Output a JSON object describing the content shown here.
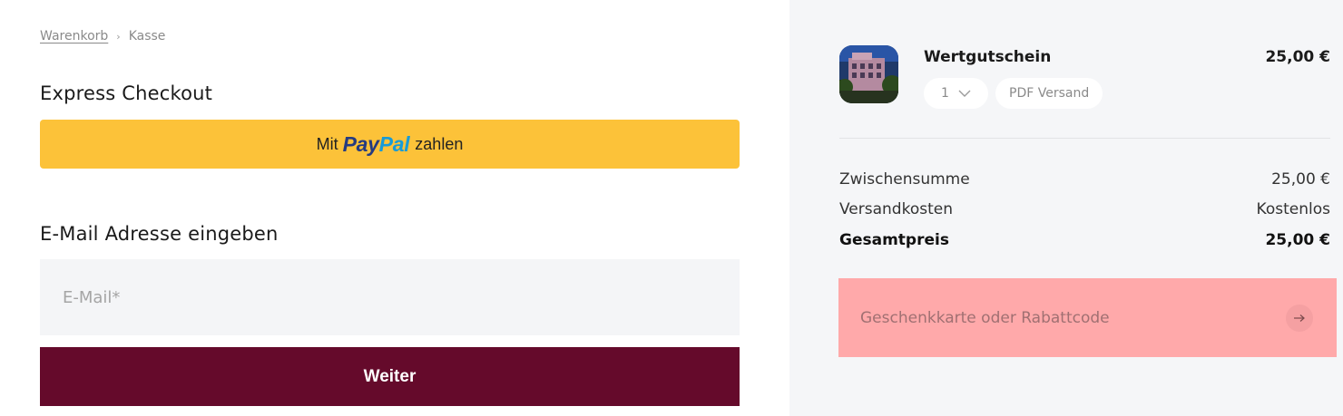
{
  "breadcrumb": {
    "cart": "Warenkorb",
    "separator": "›",
    "current": "Kasse"
  },
  "express": {
    "title": "Express Checkout",
    "paypal_prefix": "Mit",
    "paypal_logo_pay": "Pay",
    "paypal_logo_pal": "Pal",
    "paypal_suffix": "zahlen"
  },
  "email": {
    "title": "E-Mail Adresse eingeben",
    "placeholder": "E-Mail*",
    "submit_label": "Weiter"
  },
  "cart": {
    "item": {
      "name": "Wertgutschein",
      "price": "25,00 €",
      "quantity": "1",
      "shipping_method": "PDF Versand"
    },
    "summary": [
      {
        "label": "Zwischensumme",
        "value": "25,00 €"
      },
      {
        "label": "Versandkosten",
        "value": "Kostenlos"
      },
      {
        "label": "Gesamtpreis",
        "value": "25,00 €"
      }
    ],
    "coupon_placeholder": "Geschenkkarte oder Rabattcode"
  },
  "colors": {
    "paypal_button": "#fcc239",
    "submit_button": "#650a2b",
    "coupon_highlight": "#ffa9aa",
    "sidebar_background": "#f5f6f8"
  },
  "icons": {
    "quantity_dropdown": "chevron-down-icon",
    "coupon_submit": "arrow-right-icon"
  }
}
